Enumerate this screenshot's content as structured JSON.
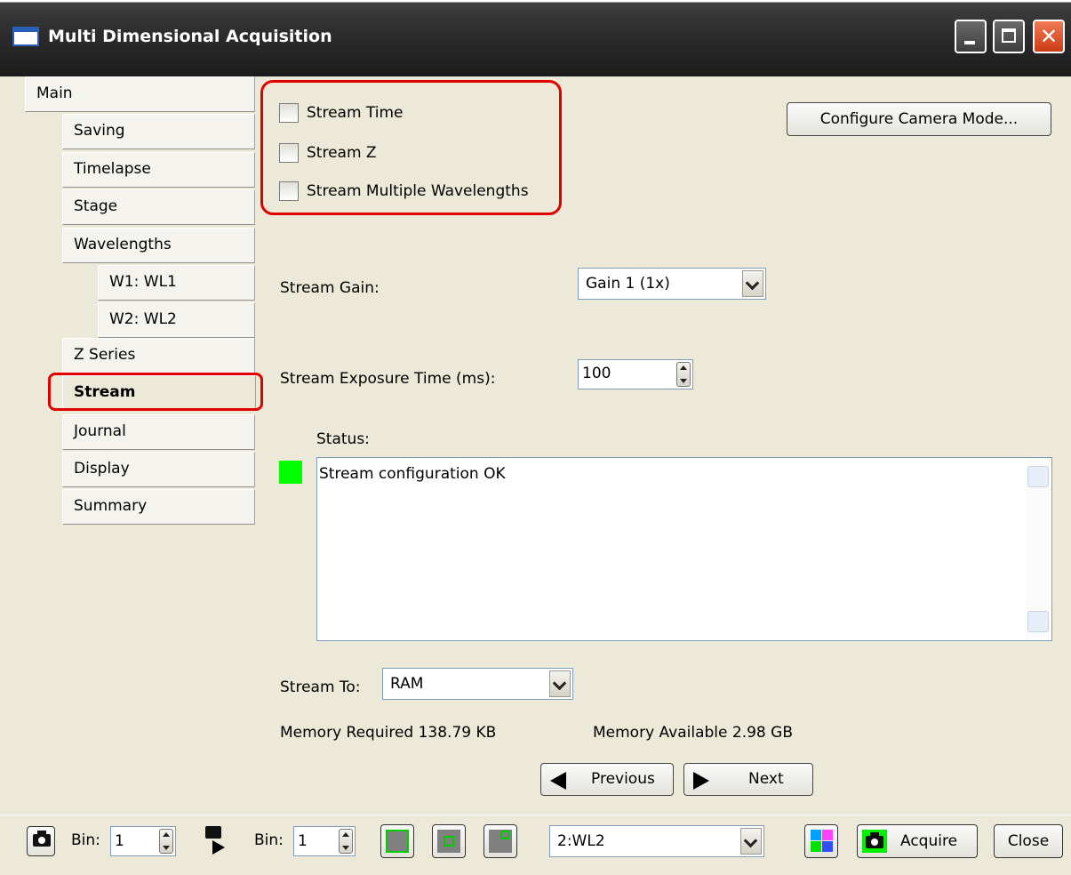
{
  "window": {
    "title": "Multi Dimensional Acquisition"
  },
  "nav": {
    "tabs": [
      {
        "label": "Main",
        "active": false
      },
      {
        "label": "Saving",
        "active": false
      },
      {
        "label": "Timelapse",
        "active": false
      },
      {
        "label": "Stage",
        "active": false
      },
      {
        "label": "Wavelengths",
        "active": false
      },
      {
        "label": "W1: WL1",
        "active": false
      },
      {
        "label": "W2: WL2",
        "active": false
      },
      {
        "label": "Z Series",
        "active": false
      },
      {
        "label": "Stream",
        "active": true
      },
      {
        "label": "Journal",
        "active": false
      },
      {
        "label": "Display",
        "active": false
      },
      {
        "label": "Summary",
        "active": false
      }
    ]
  },
  "stream": {
    "checkboxes": [
      {
        "label": "Stream Time",
        "checked": false
      },
      {
        "label": "Stream Z",
        "checked": false
      },
      {
        "label": "Stream Multiple Wavelengths",
        "checked": false
      }
    ],
    "configure_button": "Configure Camera Mode...",
    "gain_label": "Stream Gain:",
    "gain_value": "Gain 1 (1x)",
    "exposure_label": "Stream Exposure Time (ms):",
    "exposure_value": "100",
    "status_label": "Status:",
    "status_color": "#00ff00",
    "status_text": "Stream configuration OK",
    "stream_to_label": "Stream To:",
    "stream_to_value": "RAM",
    "memory_required": "Memory Required 138.79 KB",
    "memory_available": "Memory Available 2.98 GB",
    "previous_label": "Previous",
    "next_label": "Next"
  },
  "bottom": {
    "bin_label_1": "Bin:",
    "bin_value_1": "1",
    "bin_label_2": "Bin:",
    "bin_value_2": "1",
    "wavelength_value": "2:WL2",
    "acquire_label": "Acquire",
    "close_label": "Close"
  },
  "colors": {
    "highlight": "#e00000",
    "status_ok": "#00ff00",
    "roi_green": "#00cc00"
  }
}
